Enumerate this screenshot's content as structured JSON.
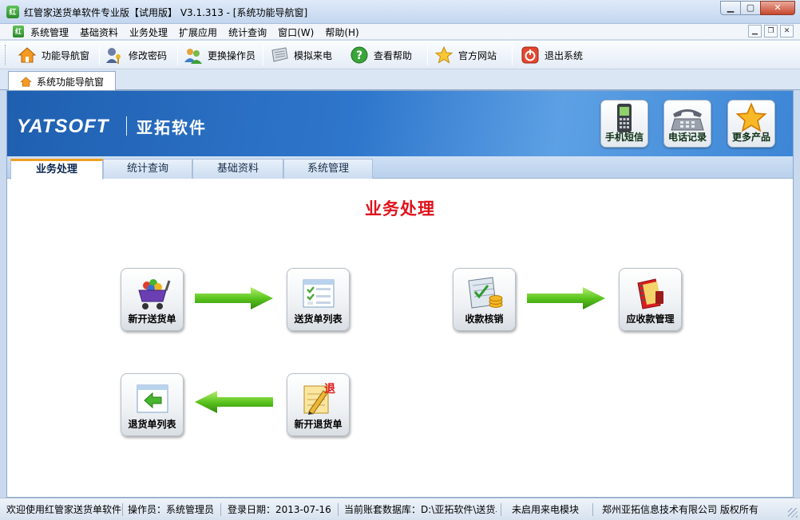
{
  "window": {
    "title": "红管家送货单软件专业版【试用版】 V3.1.313 - [系统功能导航窗]",
    "app_icon": "红管家-logo-icon",
    "controls": [
      "minimize",
      "maximize",
      "close"
    ]
  },
  "menu": {
    "items": [
      "系统管理",
      "基础资料",
      "业务处理",
      "扩展应用",
      "统计查询",
      "窗口(W)",
      "帮助(H)"
    ]
  },
  "toolbar": {
    "items": [
      {
        "label": "功能导航窗",
        "icon": "home-icon"
      },
      {
        "label": "修改密码",
        "icon": "key-user-icon"
      },
      {
        "label": "更换操作员",
        "icon": "users-icon"
      },
      {
        "label": "模拟来电",
        "icon": "phone-book-icon"
      },
      {
        "label": "查看帮助",
        "icon": "help-icon"
      },
      {
        "label": "官方网站",
        "icon": "star-icon"
      },
      {
        "label": "退出系统",
        "icon": "power-icon"
      }
    ]
  },
  "doc_tab": {
    "label": "系统功能导航窗",
    "icon": "home-icon"
  },
  "banner": {
    "brand": "YATSOFT",
    "brand_cn": "亚拓软件",
    "promos": [
      {
        "label": "手机短信",
        "icon": "mobile-phone-icon"
      },
      {
        "label": "电话记录",
        "icon": "telephone-icon"
      },
      {
        "label": "更多产品",
        "icon": "star-icon"
      }
    ]
  },
  "module_tabs": [
    "业务处理",
    "统计查询",
    "基础资料",
    "系统管理"
  ],
  "section": {
    "title": "业务处理",
    "functions": [
      {
        "label": "新开送货单",
        "icon": "shopping-cart-icon"
      },
      {
        "label": "送货单列表",
        "icon": "checklist-icon"
      },
      {
        "label": "收款核销",
        "icon": "coins-ledger-icon"
      },
      {
        "label": "应收款管理",
        "icon": "red-notebook-icon"
      },
      {
        "label": "退货单列表",
        "icon": "return-list-icon"
      },
      {
        "label": "新开退货单",
        "icon": "return-edit-icon"
      }
    ],
    "return_badge": "退"
  },
  "status": {
    "welcome": "欢迎使用红管家送货单软件专业版",
    "operator": "操作员：系统管理员",
    "login_date": "登录日期：2013-07-16",
    "database": "当前账套数据库：D:\\亚拓软件\\送货单软件\\Data",
    "caller_id": "未启用来电模块",
    "copyright": "郑州亚拓信息技术有限公司 版权所有"
  },
  "colors": {
    "section_title": "#e0121b",
    "banner_blue": "#2f77cc",
    "arrow_green": "#5cc51f"
  }
}
